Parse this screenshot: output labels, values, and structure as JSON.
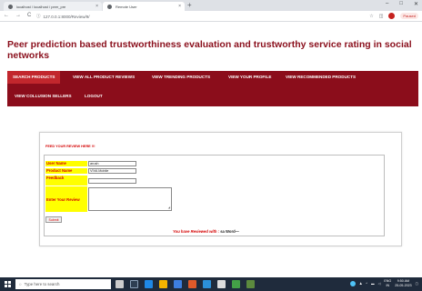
{
  "browser": {
    "tabs": [
      {
        "title": "localhost / localhost / peer_pre",
        "close": "×"
      },
      {
        "title": "Remote User",
        "close": "×"
      }
    ],
    "new_tab": "+",
    "window_controls": [
      "–",
      "□",
      "✕"
    ],
    "nav": [
      "←",
      "→",
      "C"
    ],
    "url": "127.0.0.1:8000/Review/9/",
    "paused_label": "Paused"
  },
  "page": {
    "title": "Peer prediction based trustworthiness evaluation and trustworthy service rating in social networks"
  },
  "nav": {
    "items": [
      {
        "label": "SEARCH PRODUCTS",
        "active": true
      },
      {
        "label": "VIEW ALL PRODUCT REVIEWS",
        "active": false
      },
      {
        "label": "VIEW TRENDING PRODUCTS",
        "active": false
      },
      {
        "label": "VIEW YOUR PROFILE",
        "active": false
      },
      {
        "label": "VIEW RECOMMENDED PRODUCTS",
        "active": false
      },
      {
        "label": "VIEW COLLUSION SELLERS",
        "active": false
      },
      {
        "label": "LOGOUT",
        "active": false
      }
    ]
  },
  "form": {
    "heading": "FEED YOUR REVIEW HERE !!!",
    "user_name_label": "User Name",
    "user_name_value": "arush",
    "product_name_label": "Product Name",
    "product_name_value": "VIVA Mobile",
    "feedback_label": "Feedback",
    "feedback_value": "",
    "review_label": "Enter Your Review",
    "submit_label": "Submit",
    "result_prefix": "You have Reviewed with :",
    "result_value": "sa Word—"
  },
  "taskbar": {
    "search_placeholder": "Type here to search",
    "tray_lang": "ENG",
    "tray_region": "IN",
    "time": "9:50 AM",
    "date": "25-05-2023"
  },
  "colors": {
    "brand": "#8b0d1b",
    "active_nav": "#c2272d",
    "label_bg": "#ffff00",
    "label_text": "#d40000"
  }
}
